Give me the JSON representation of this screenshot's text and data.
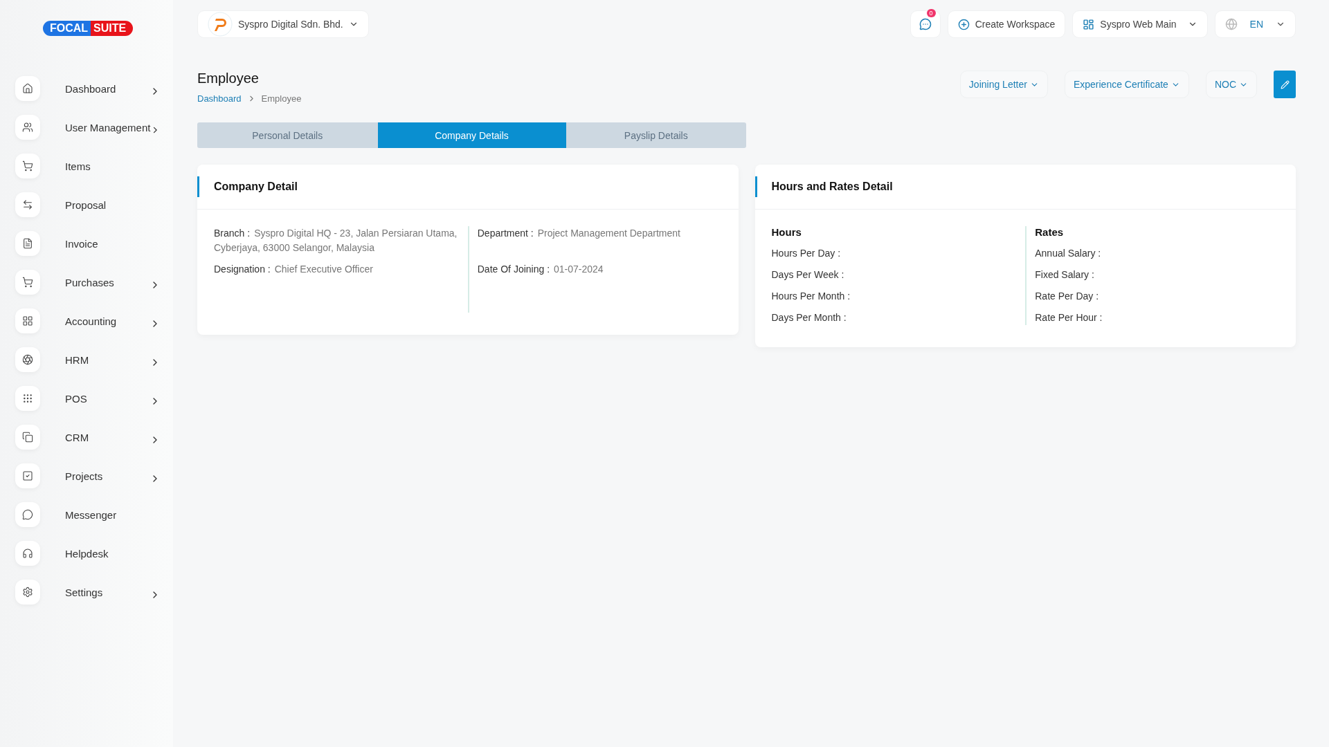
{
  "logo": {
    "part_1": "FOCAL",
    "part_2": "SUITE"
  },
  "company_selector": {
    "label": "Syspro Digital Sdn. Bhd."
  },
  "topbar": {
    "notifications": "0",
    "create_workspace": "Create Workspace",
    "workspace": "Syspro Web Main",
    "language": "EN"
  },
  "sidebar": {
    "items": [
      {
        "label": "Dashboard",
        "expandable": true
      },
      {
        "label": "User Management",
        "expandable": true
      },
      {
        "label": "Items",
        "expandable": false
      },
      {
        "label": "Proposal",
        "expandable": false
      },
      {
        "label": "Invoice",
        "expandable": false
      },
      {
        "label": "Purchases",
        "expandable": true
      },
      {
        "label": "Accounting",
        "expandable": true
      },
      {
        "label": "HRM",
        "expandable": true
      },
      {
        "label": "POS",
        "expandable": true
      },
      {
        "label": "CRM",
        "expandable": true
      },
      {
        "label": "Projects",
        "expandable": true
      },
      {
        "label": "Messenger",
        "expandable": false
      },
      {
        "label": "Helpdesk",
        "expandable": false
      },
      {
        "label": "Settings",
        "expandable": true
      }
    ]
  },
  "page": {
    "title": "Employee",
    "breadcrumb": [
      "Dashboard",
      "Employee"
    ],
    "actions": [
      "Joining Letter",
      "Experience Certificate",
      "NOC"
    ]
  },
  "tabs": [
    {
      "label": "Personal Details",
      "selected": false
    },
    {
      "label": "Company Details",
      "selected": true
    },
    {
      "label": "Payslip Details",
      "selected": false
    }
  ],
  "company_detail": {
    "title": "Company Detail",
    "columns": [
      [
        {
          "label": "Branch :",
          "value": "Syspro Digital HQ - 23, Jalan Persiaran Utama, Cyberjaya, 63000 Selangor, Malaysia"
        },
        {
          "label": "Designation :",
          "value": "Chief Executive Officer"
        }
      ],
      [
        {
          "label": "Department :",
          "value": "Project Management Department"
        },
        {
          "label": "Date Of Joining :",
          "value": "01-07-2024"
        }
      ]
    ]
  },
  "hours_rates": {
    "title": "Hours and Rates Detail",
    "columns": [
      {
        "heading": "Hours",
        "fields": [
          "Hours Per Day :",
          "Days Per Week :",
          "Hours Per Month :",
          "Days Per Month :"
        ]
      },
      {
        "heading": "Rates",
        "fields": [
          "Annual Salary :",
          "Fixed Salary :",
          "Rate Per Day :",
          "Rate Per Hour :"
        ]
      }
    ]
  }
}
